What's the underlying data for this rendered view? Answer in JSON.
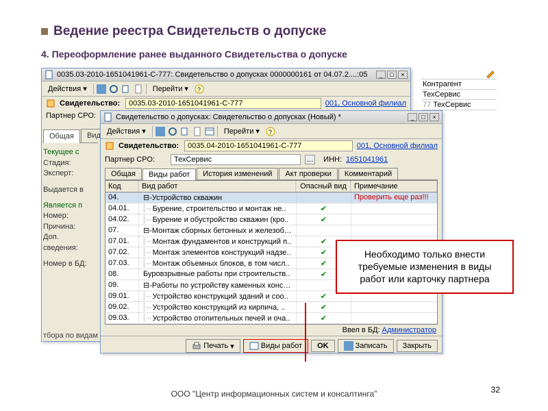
{
  "slide": {
    "title": "Ведение реестра Свидетельств о допуске",
    "subtitle": "4. Переоформление ранее выданного Свидетельства о допуске"
  },
  "back_win": {
    "title": "0035.03-2010-1651041961-С-777: Свидетельство о допусках 0000000161 от 04.07.2....:05",
    "actions": "Действия",
    "goto": "Перейти",
    "cert_label": "Свидетельство:",
    "cert_value": "0035.03-2010-1651041961-С-777",
    "branch": "001, Основной филиал",
    "partner_label": "Партнер СРО:",
    "tab1": "Общая",
    "tab2": "Виды",
    "grp1": "Текущее с",
    "stage": "Стадия:",
    "expert": "Эксперт:",
    "issued": "Выдается в",
    "grp2": "Является п",
    "number": "Номер:",
    "reason": "Причина:",
    "extra": "Доп.\nсведения:",
    "dbnum": "Номер в БД:",
    "filter": "тбора по видам ра"
  },
  "front_win": {
    "title": "Свидетельство о допусках: Свидетельство о допусках (Новый) *",
    "actions": "Действия",
    "goto": "Перейти",
    "cert_label": "Свидетельство:",
    "cert_value": "0035.04-2010-1651041961-С-777",
    "branch": "001, Основной филиал",
    "partner_label": "Партнер СРО:",
    "partner_value": "ТехСервис",
    "inn_label": "ИНН:",
    "inn_value": "1651041961",
    "tabs": [
      "Общая",
      "Виды работ",
      "История изменений",
      "Акт проверки",
      "Комментарий"
    ],
    "columns": {
      "code": "Код",
      "name": "Вид работ",
      "dop": "Опасный вид",
      "note": "Примечание"
    },
    "note_hint": "Проверить еще раз!!!",
    "rows": [
      {
        "code": "04.",
        "name": "⊟-Устройство скважин",
        "sel": true
      },
      {
        "code": "04.01.",
        "name": "Бурение, строительство и монтаж не..",
        "check": true,
        "ind": 1
      },
      {
        "code": "04.02.",
        "name": "Бурение и обустройство скважин (кро..",
        "check": true,
        "ind": 1
      },
      {
        "code": "07.",
        "name": "⊟-Монтаж сборных бетонных и железобето.."
      },
      {
        "code": "07.01.",
        "name": "Монтаж фундаментов и конструкций п..",
        "check": true,
        "ind": 1
      },
      {
        "code": "07.02.",
        "name": "Монтаж элементов конструкций надзе..",
        "check": true,
        "ind": 1
      },
      {
        "code": "07.03.",
        "name": "Монтаж объемных блоков, в том числ..",
        "check": true,
        "ind": 1
      },
      {
        "code": "08.",
        "name": "Буровзрывные работы при строительств..",
        "check": true
      },
      {
        "code": "09.",
        "name": "⊟-Работы по устройству каменных конструк.."
      },
      {
        "code": "09.01.",
        "name": "Устройство конструкций зданий и соо..",
        "check": true,
        "ind": 1
      },
      {
        "code": "09.02.",
        "name": "Устройство конструкций из кирпича, ..",
        "check": true,
        "ind": 1
      },
      {
        "code": "09.03.",
        "name": "Устройство отопительных печей и оча..",
        "check": true,
        "ind": 1
      }
    ],
    "db_label": "Ввел в БД:",
    "db_user": "Администратор",
    "print": "Печать",
    "works": "Виды работ",
    "ok": "OK",
    "save": "Записать",
    "close": "Закрыть"
  },
  "side": {
    "kontragent": "Контрагент",
    "tekhservice": "ТехСервис",
    "num": "77"
  },
  "callout": "Необходимо только внести требуемые изменения в виды работ или карточку партнера",
  "footer": "ООО \"Центр информационных систем и консалтинга\"",
  "page": "32"
}
